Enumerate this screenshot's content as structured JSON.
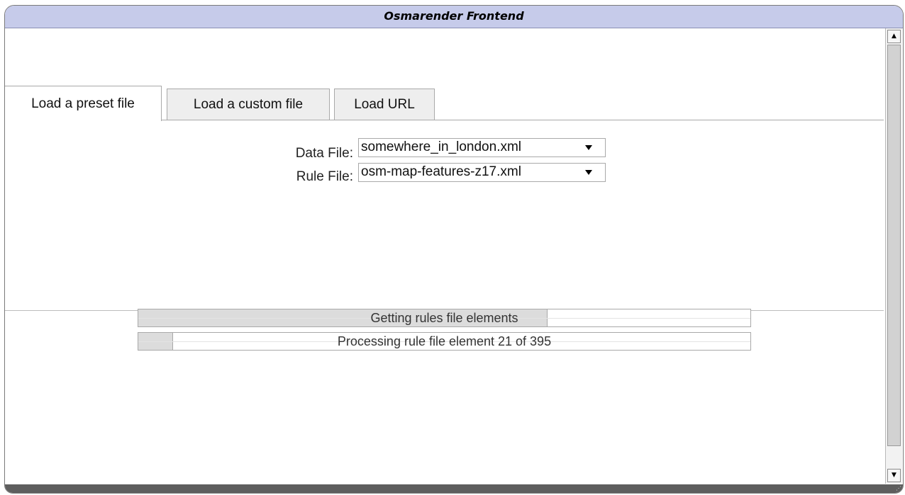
{
  "window": {
    "title": "Osmarender Frontend"
  },
  "tabs": [
    {
      "label": "Load a preset file",
      "active": true
    },
    {
      "label": "Load a custom file",
      "active": false
    },
    {
      "label": "Load URL",
      "active": false
    }
  ],
  "form": {
    "data_file_label": "Data File:",
    "data_file_value": "somewhere_in_london.xml",
    "rule_file_label": "Rule File:",
    "rule_file_value": "osm-map-features-z17.xml"
  },
  "progress": [
    {
      "text": "Getting rules file elements",
      "fraction": 0.667
    },
    {
      "text": "Processing rule file element 21 of 395",
      "fraction": 0.056
    }
  ],
  "icons": {
    "dropdown": "chevron-down-icon",
    "scroll_up": "scroll-up-icon",
    "scroll_down": "scroll-down-icon",
    "resize": "resize-grip-icon"
  },
  "colors": {
    "titlebar": "#c6cbea",
    "progress_fill": "#dcdcdc",
    "bottom_bar": "#5e5e5e"
  }
}
